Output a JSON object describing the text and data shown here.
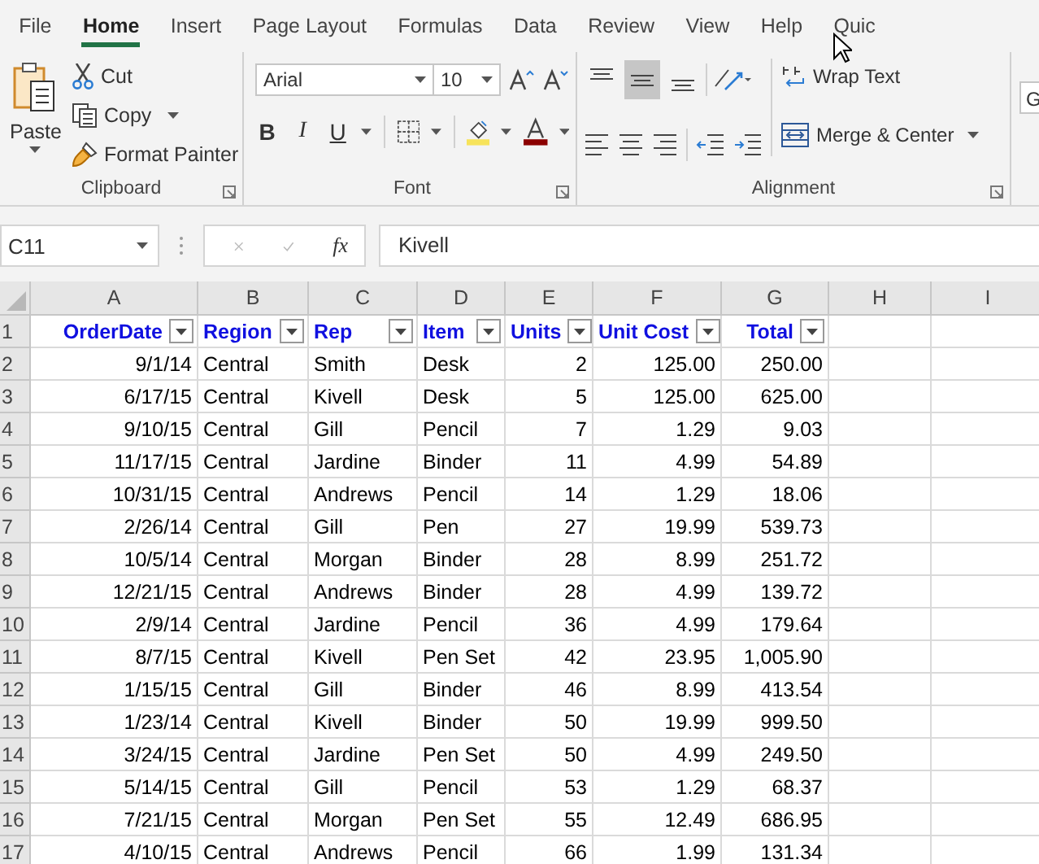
{
  "tabs": [
    {
      "label": "File",
      "selected": false
    },
    {
      "label": "Home",
      "selected": true
    },
    {
      "label": "Insert",
      "selected": false
    },
    {
      "label": "Page Layout",
      "selected": false
    },
    {
      "label": "Formulas",
      "selected": false
    },
    {
      "label": "Data",
      "selected": false
    },
    {
      "label": "Review",
      "selected": false
    },
    {
      "label": "View",
      "selected": false
    },
    {
      "label": "Help",
      "selected": false
    },
    {
      "label": "Quic",
      "selected": false
    }
  ],
  "clipboard": {
    "paste": "Paste",
    "cut": "Cut",
    "copy": "Copy",
    "format_painter": "Format Painter",
    "group_label": "Clipboard"
  },
  "font": {
    "name": "Arial",
    "size": "10",
    "bold": "B",
    "italic": "I",
    "underline": "U",
    "group_label": "Font"
  },
  "alignment": {
    "vertical": [
      {
        "selected": false
      },
      {
        "selected": true
      },
      {
        "selected": false
      }
    ],
    "wrap_text": "Wrap Text",
    "merge": "Merge & Center",
    "group_label": "Alignment"
  },
  "number": {
    "format": "G"
  },
  "formula_bar": {
    "name_box": "C11",
    "fx": "fx",
    "value": "Kivell"
  },
  "sheet": {
    "columns": [
      "A",
      "B",
      "C",
      "D",
      "E",
      "F",
      "G",
      "H",
      "I"
    ],
    "header_row_number": "1",
    "headers": [
      "OrderDate",
      "Region",
      "Rep",
      "Item",
      "Units",
      "Unit Cost",
      "Total"
    ],
    "rows": [
      {
        "n": "2",
        "cells": [
          "9/1/14",
          "Central",
          "Smith",
          "Desk",
          "2",
          "125.00",
          "250.00"
        ]
      },
      {
        "n": "3",
        "cells": [
          "6/17/15",
          "Central",
          "Kivell",
          "Desk",
          "5",
          "125.00",
          "625.00"
        ]
      },
      {
        "n": "4",
        "cells": [
          "9/10/15",
          "Central",
          "Gill",
          "Pencil",
          "7",
          "1.29",
          "9.03"
        ]
      },
      {
        "n": "5",
        "cells": [
          "11/17/15",
          "Central",
          "Jardine",
          "Binder",
          "11",
          "4.99",
          "54.89"
        ]
      },
      {
        "n": "6",
        "cells": [
          "10/31/15",
          "Central",
          "Andrews",
          "Pencil",
          "14",
          "1.29",
          "18.06"
        ]
      },
      {
        "n": "7",
        "cells": [
          "2/26/14",
          "Central",
          "Gill",
          "Pen",
          "27",
          "19.99",
          "539.73"
        ]
      },
      {
        "n": "8",
        "cells": [
          "10/5/14",
          "Central",
          "Morgan",
          "Binder",
          "28",
          "8.99",
          "251.72"
        ]
      },
      {
        "n": "9",
        "cells": [
          "12/21/15",
          "Central",
          "Andrews",
          "Binder",
          "28",
          "4.99",
          "139.72"
        ]
      },
      {
        "n": "10",
        "cells": [
          "2/9/14",
          "Central",
          "Jardine",
          "Pencil",
          "36",
          "4.99",
          "179.64"
        ]
      },
      {
        "n": "11",
        "cells": [
          "8/7/15",
          "Central",
          "Kivell",
          "Pen Set",
          "42",
          "23.95",
          "1,005.90"
        ]
      },
      {
        "n": "12",
        "cells": [
          "1/15/15",
          "Central",
          "Gill",
          "Binder",
          "46",
          "8.99",
          "413.54"
        ]
      },
      {
        "n": "13",
        "cells": [
          "1/23/14",
          "Central",
          "Kivell",
          "Binder",
          "50",
          "19.99",
          "999.50"
        ]
      },
      {
        "n": "14",
        "cells": [
          "3/24/15",
          "Central",
          "Jardine",
          "Pen Set",
          "50",
          "4.99",
          "249.50"
        ]
      },
      {
        "n": "15",
        "cells": [
          "5/14/15",
          "Central",
          "Gill",
          "Pencil",
          "53",
          "1.29",
          "68.37"
        ]
      },
      {
        "n": "16",
        "cells": [
          "7/21/15",
          "Central",
          "Morgan",
          "Pen Set",
          "55",
          "12.49",
          "686.95"
        ]
      },
      {
        "n": "17",
        "cells": [
          "4/10/15",
          "Central",
          "Andrews",
          "Pencil",
          "66",
          "1.99",
          "131.34"
        ]
      }
    ]
  }
}
